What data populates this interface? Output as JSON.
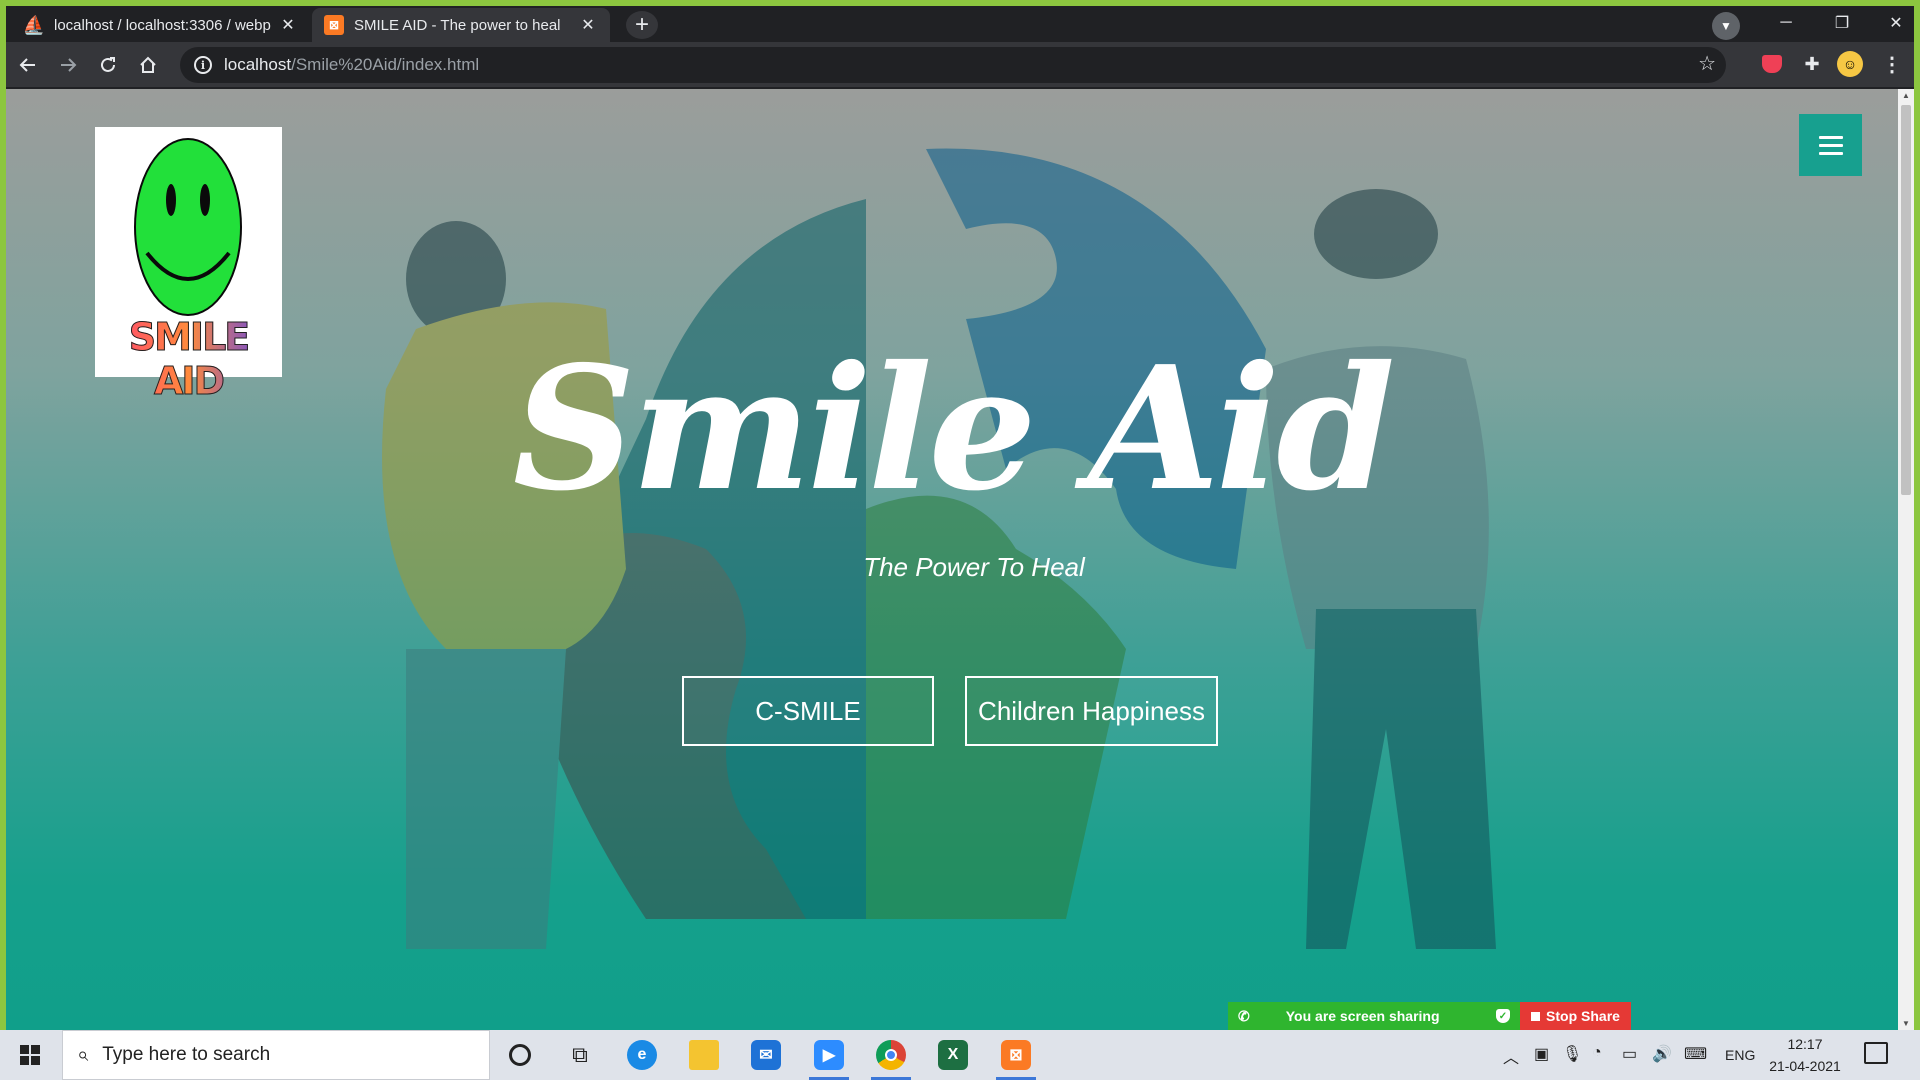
{
  "browser": {
    "tabs": [
      {
        "title": "localhost / localhost:3306 / webp",
        "favicon": "phpmyadmin-icon",
        "active": false
      },
      {
        "title": "SMILE AID - The power to heal",
        "favicon": "xampp-icon",
        "active": true
      }
    ],
    "url_host": "localhost",
    "url_path": "/Smile%20Aid/index.html"
  },
  "page": {
    "logo_text": "SMILE AID",
    "hero_title": "Smile Aid",
    "hero_subtitle": "The Power To Heal",
    "buttons": [
      {
        "label": "C-SMILE"
      },
      {
        "label": "Children Happiness"
      }
    ],
    "colors": {
      "accent": "#17a08f",
      "logo_face": "#22e03a"
    }
  },
  "screen_share": {
    "status": "You are screen sharing",
    "stop_label": "Stop Share"
  },
  "taskbar": {
    "search_placeholder": "Type here to search",
    "apps": [
      "cortana-icon",
      "task-view-icon",
      "edge-icon",
      "file-explorer-icon",
      "mail-icon",
      "zoom-icon",
      "chrome-icon",
      "excel-icon",
      "xampp-icon"
    ],
    "language": "ENG",
    "time": "12:17",
    "date": "21-04-2021"
  }
}
